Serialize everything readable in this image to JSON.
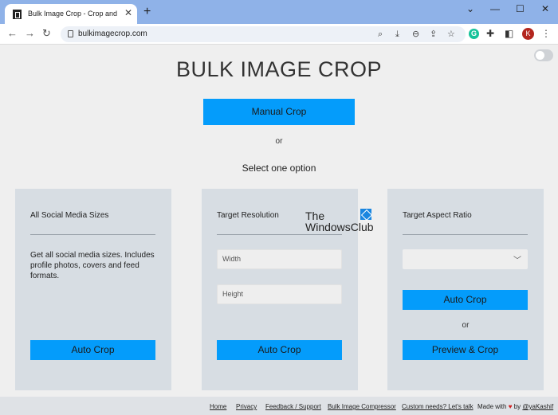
{
  "browser": {
    "tab_title": "Bulk Image Crop - Crop and Resi",
    "url": "bulkimagecrop.com",
    "avatar_initial": "K",
    "grammarly_label": "G"
  },
  "page": {
    "title": "BULK IMAGE CROP",
    "manual_crop": "Manual Crop",
    "or": "or",
    "select_option": "Select one option"
  },
  "cards": {
    "social": {
      "title": "All Social Media Sizes",
      "description": "Get all social media sizes. Includes profile photos, covers and feed formats.",
      "button": "Auto Crop"
    },
    "resolution": {
      "title": "Target Resolution",
      "width_placeholder": "Width",
      "height_placeholder": "Height",
      "button": "Auto Crop"
    },
    "aspect": {
      "title": "Target Aspect Ratio",
      "selected": "",
      "auto_button": "Auto Crop",
      "or": "or",
      "preview_button": "Preview & Crop"
    }
  },
  "watermark": {
    "line1": "The",
    "line2": "WindowsClub"
  },
  "footer": {
    "links": [
      "Home",
      "Privacy",
      "Feedback / Support",
      "Bulk Image Compressor",
      "Custom needs? Let's talk"
    ],
    "made_with": "Made with",
    "by": "by",
    "author": "@yaKashif"
  },
  "colors": {
    "accent": "#049cfb",
    "card_bg": "#d7dde3",
    "page_bg": "#efefef"
  }
}
